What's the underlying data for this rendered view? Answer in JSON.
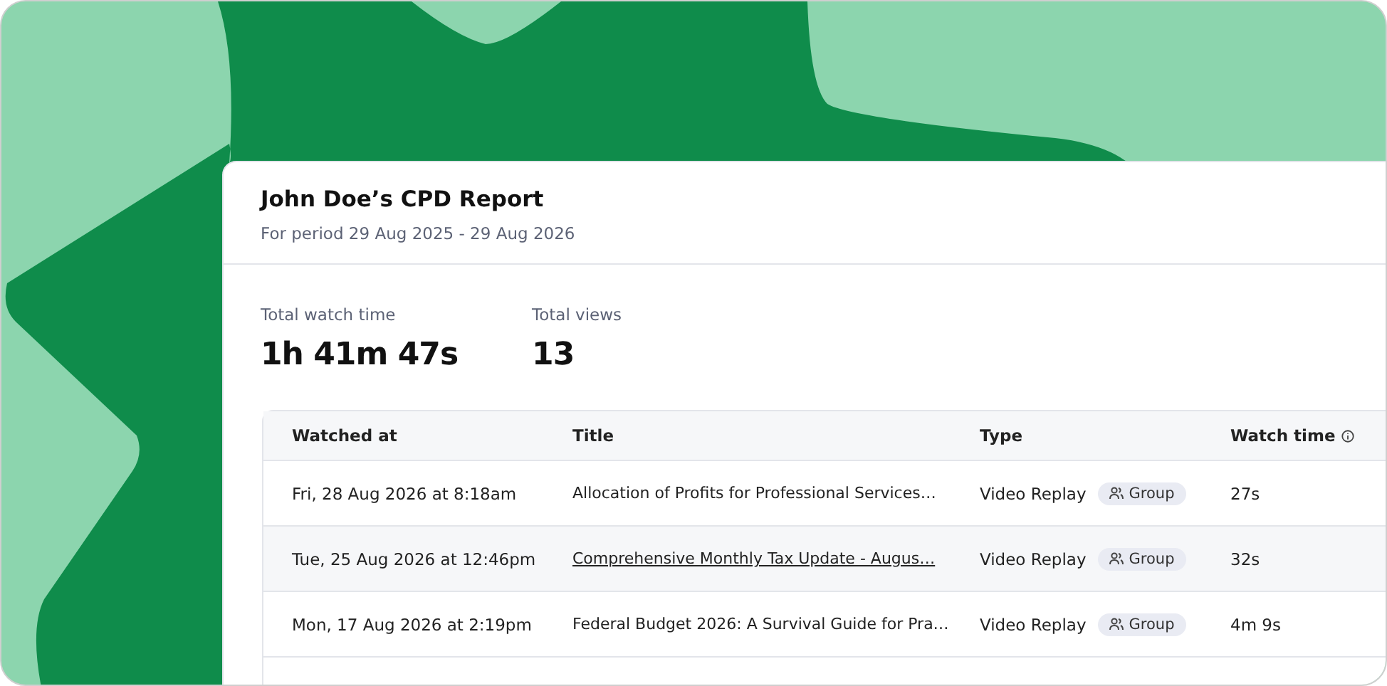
{
  "report": {
    "title": "John Doe’s CPD Report",
    "period": "For period 29 Aug 2025 - 29 Aug 2026"
  },
  "stats": [
    {
      "label": "Total watch time",
      "value": "1h 41m 47s"
    },
    {
      "label": "Total views",
      "value": "13"
    }
  ],
  "table": {
    "columns": [
      "Watched at",
      "Title",
      "Type",
      "Watch time"
    ],
    "rows": [
      {
        "watched_at": "Fri, 28 Aug 2026 at 8:18am",
        "title": "Allocation of Profits for Professional Services…",
        "type": "Video Replay",
        "badge": "Group",
        "watch_time": "27s",
        "highlighted": false
      },
      {
        "watched_at": "Tue, 25 Aug 2026 at 12:46pm",
        "title": "Comprehensive Monthly Tax Update - Augus…",
        "type": "Video Replay",
        "badge": "Group",
        "watch_time": "32s",
        "highlighted": true
      },
      {
        "watched_at": "Mon, 17 Aug 2026 at 2:19pm",
        "title": "Federal Budget 2026: A Survival Guide for Pra…",
        "type": "Video Replay",
        "badge": "Group",
        "watch_time": "4m 9s",
        "highlighted": false
      }
    ]
  }
}
